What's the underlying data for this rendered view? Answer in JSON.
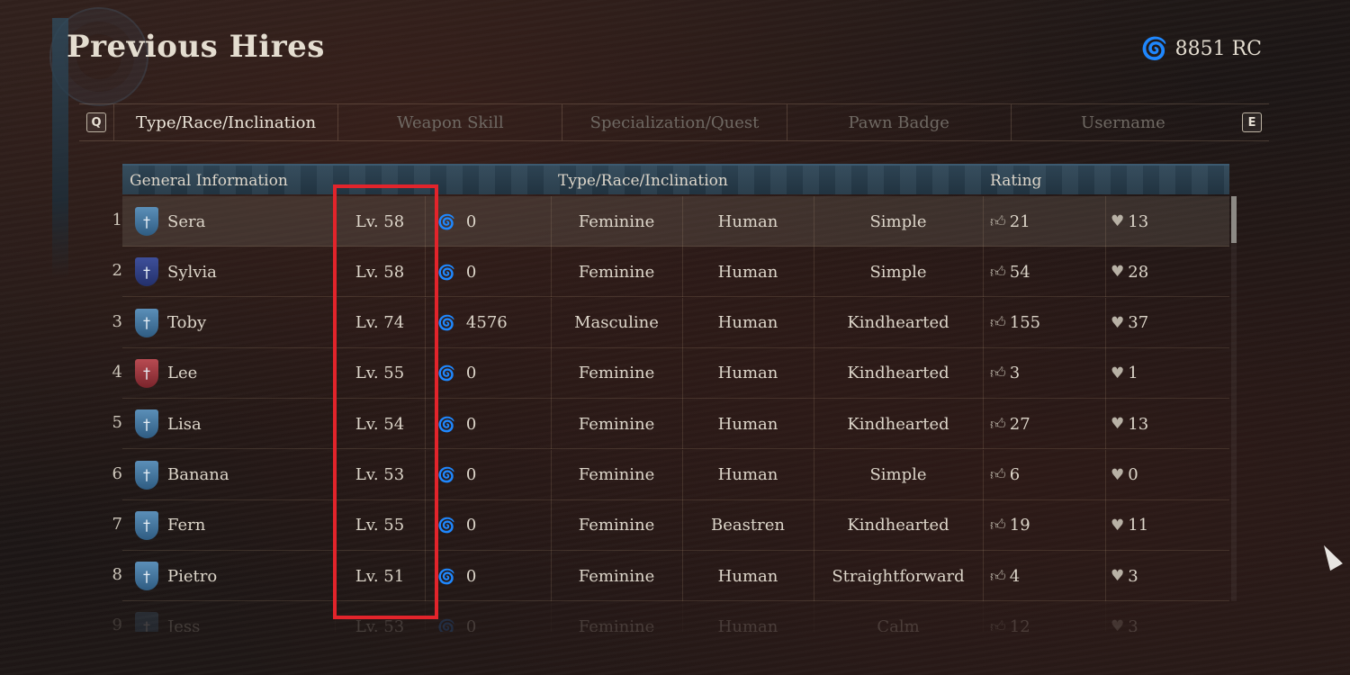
{
  "title": "Previous Hires",
  "currency": {
    "icon": "swirl-icon",
    "amount": "8851 RC"
  },
  "tabs": {
    "prev_key": "Q",
    "next_key": "E",
    "items": [
      {
        "label": "Type/Race/Inclination",
        "active": true
      },
      {
        "label": "Weapon Skill",
        "active": false
      },
      {
        "label": "Specialization/Quest",
        "active": false
      },
      {
        "label": "Pawn Badge",
        "active": false
      },
      {
        "label": "Username",
        "active": false
      }
    ]
  },
  "table": {
    "headers": {
      "general": "General Information",
      "type": "Type/Race/Inclination",
      "rating": "Rating"
    },
    "rows": [
      {
        "rank": "1",
        "name": "Sera",
        "shield": "blue",
        "level": "Lv. 58",
        "rc": "0",
        "gender": "Feminine",
        "race": "Human",
        "inclination": "Simple",
        "likes": "21",
        "hearts": "13",
        "selected": true
      },
      {
        "rank": "2",
        "name": "Sylvia",
        "shield": "navy",
        "level": "Lv. 58",
        "rc": "0",
        "gender": "Feminine",
        "race": "Human",
        "inclination": "Simple",
        "likes": "54",
        "hearts": "28"
      },
      {
        "rank": "3",
        "name": "Toby",
        "shield": "blue",
        "level": "Lv. 74",
        "rc": "4576",
        "gender": "Masculine",
        "race": "Human",
        "inclination": "Kindhearted",
        "likes": "155",
        "hearts": "37"
      },
      {
        "rank": "4",
        "name": "Lee",
        "shield": "red",
        "level": "Lv. 55",
        "rc": "0",
        "gender": "Feminine",
        "race": "Human",
        "inclination": "Kindhearted",
        "likes": "3",
        "hearts": "1"
      },
      {
        "rank": "5",
        "name": "Lisa",
        "shield": "blue",
        "level": "Lv. 54",
        "rc": "0",
        "gender": "Feminine",
        "race": "Human",
        "inclination": "Kindhearted",
        "likes": "27",
        "hearts": "13"
      },
      {
        "rank": "6",
        "name": "Banana",
        "shield": "blue",
        "level": "Lv. 53",
        "rc": "0",
        "gender": "Feminine",
        "race": "Human",
        "inclination": "Simple",
        "likes": "6",
        "hearts": "0"
      },
      {
        "rank": "7",
        "name": "Fern",
        "shield": "blue",
        "level": "Lv. 55",
        "rc": "0",
        "gender": "Feminine",
        "race": "Beastren",
        "inclination": "Kindhearted",
        "likes": "19",
        "hearts": "11"
      },
      {
        "rank": "8",
        "name": "Pietro",
        "shield": "blue",
        "level": "Lv. 51",
        "rc": "0",
        "gender": "Feminine",
        "race": "Human",
        "inclination": "Straightforward",
        "likes": "4",
        "hearts": "3"
      },
      {
        "rank": "9",
        "name": "Jess",
        "shield": "blue",
        "level": "Lv. 53",
        "rc": "0",
        "gender": "Feminine",
        "race": "Human",
        "inclination": "Calm",
        "likes": "12",
        "hearts": "3",
        "faded": true
      }
    ]
  },
  "colors": {
    "accent_blue": "#6fa8d8",
    "highlight_red": "#e2242b",
    "header_bg": "#2d4353"
  },
  "icons": {
    "rc": "swirl-icon",
    "like": "thumbs-up-icon",
    "heart": "heart-icon",
    "pawn": "shield-icon"
  }
}
